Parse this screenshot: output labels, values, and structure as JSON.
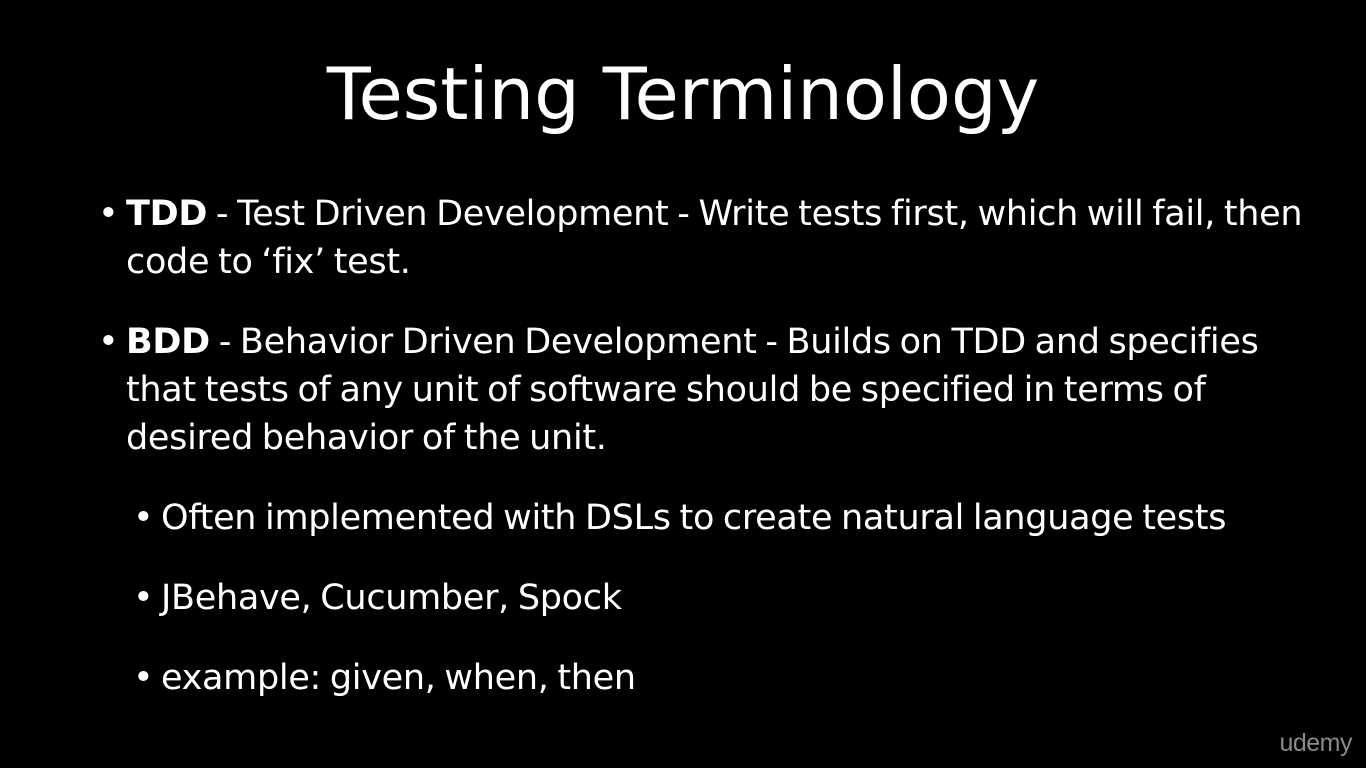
{
  "slide": {
    "title": "Testing Terminology",
    "bullets": [
      {
        "term": "TDD",
        "text": " - Test Driven Development - Write tests first, which will fail, then code to ‘fix’ test."
      },
      {
        "term": "BDD",
        "text": " - Behavior Driven Development - Builds on TDD and specifies that tests of any unit of software should be specified in terms of desired behavior of the unit."
      }
    ],
    "sub_bullets": [
      "Often implemented with DSLs to create natural language tests",
      "JBehave, Cucumber, Spock",
      "example: given, when, then"
    ],
    "bullet_glyph": "•"
  },
  "watermark": "udemy",
  "colors": {
    "background": "#000000",
    "text": "#ffffff",
    "watermark": "#8a8a8a"
  }
}
